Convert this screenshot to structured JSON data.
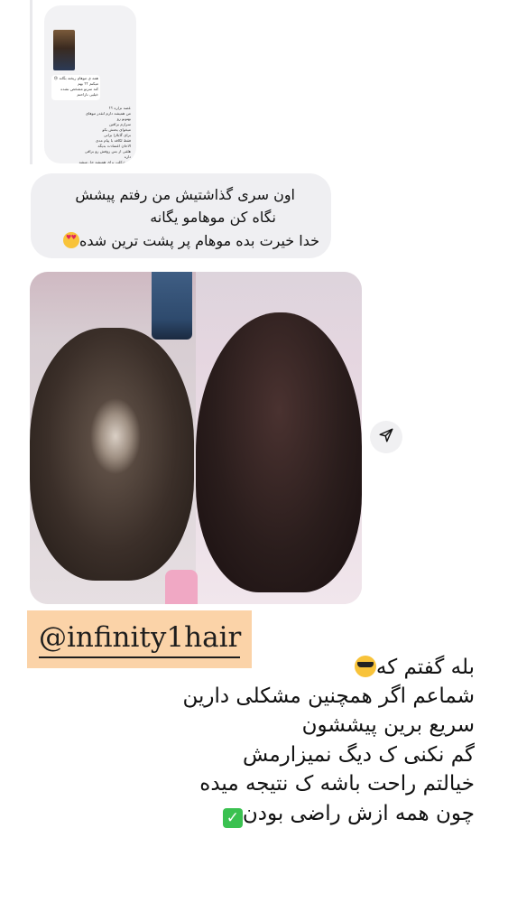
{
  "thread": {
    "mini_screenshot": {
      "message_1": "همه ی موهام ریخته بگانه 😢\nمیکنم ؟؟ بهم\nکنه سرتو مشخص نشده\nخیلیی ناراحتم",
      "message_2": "عصه نزاره ؟؟\nمن همیشه دارم انقدر موهای بهتونو رو\nسرازم براقین\nمیخوای یحتش بکو\nبرای گایلارا براتی\nفقط لکاقه با پیام مدی\nالاحان اعتمادت بدیگه\nهلقی از بس روفش رو براقی داره\nو مشکلت برای همیشه حل میشه"
    },
    "reply_bubble": {
      "line_1": "اون سری گذاشتیش من رفتم پیشش",
      "line_2": "نگاه کن موهامو یگانه",
      "line_3": "خدا خیرت بده موهام پر پشت ترین شده"
    },
    "photo": {
      "description_icon": "before-after-hair-photo"
    },
    "share_icon": "send-arrow-icon"
  },
  "handle": "@infinity1hair",
  "caption": {
    "line_1": "بله گفتم که",
    "line_2": "شماعم اگر همچنین مشکلی دارین",
    "line_3": "سریع برین پیششون",
    "line_4": "گم نکنی ک دیگ نمیزارمش",
    "line_5": "خیالتم راحت باشه ک نتیجه میده",
    "line_6": "چون همه ازش راضی بودن"
  },
  "colors": {
    "bubble_bg": "#efeff2",
    "handle_highlight": "#fbd3a8",
    "check_green": "#3ac150"
  }
}
